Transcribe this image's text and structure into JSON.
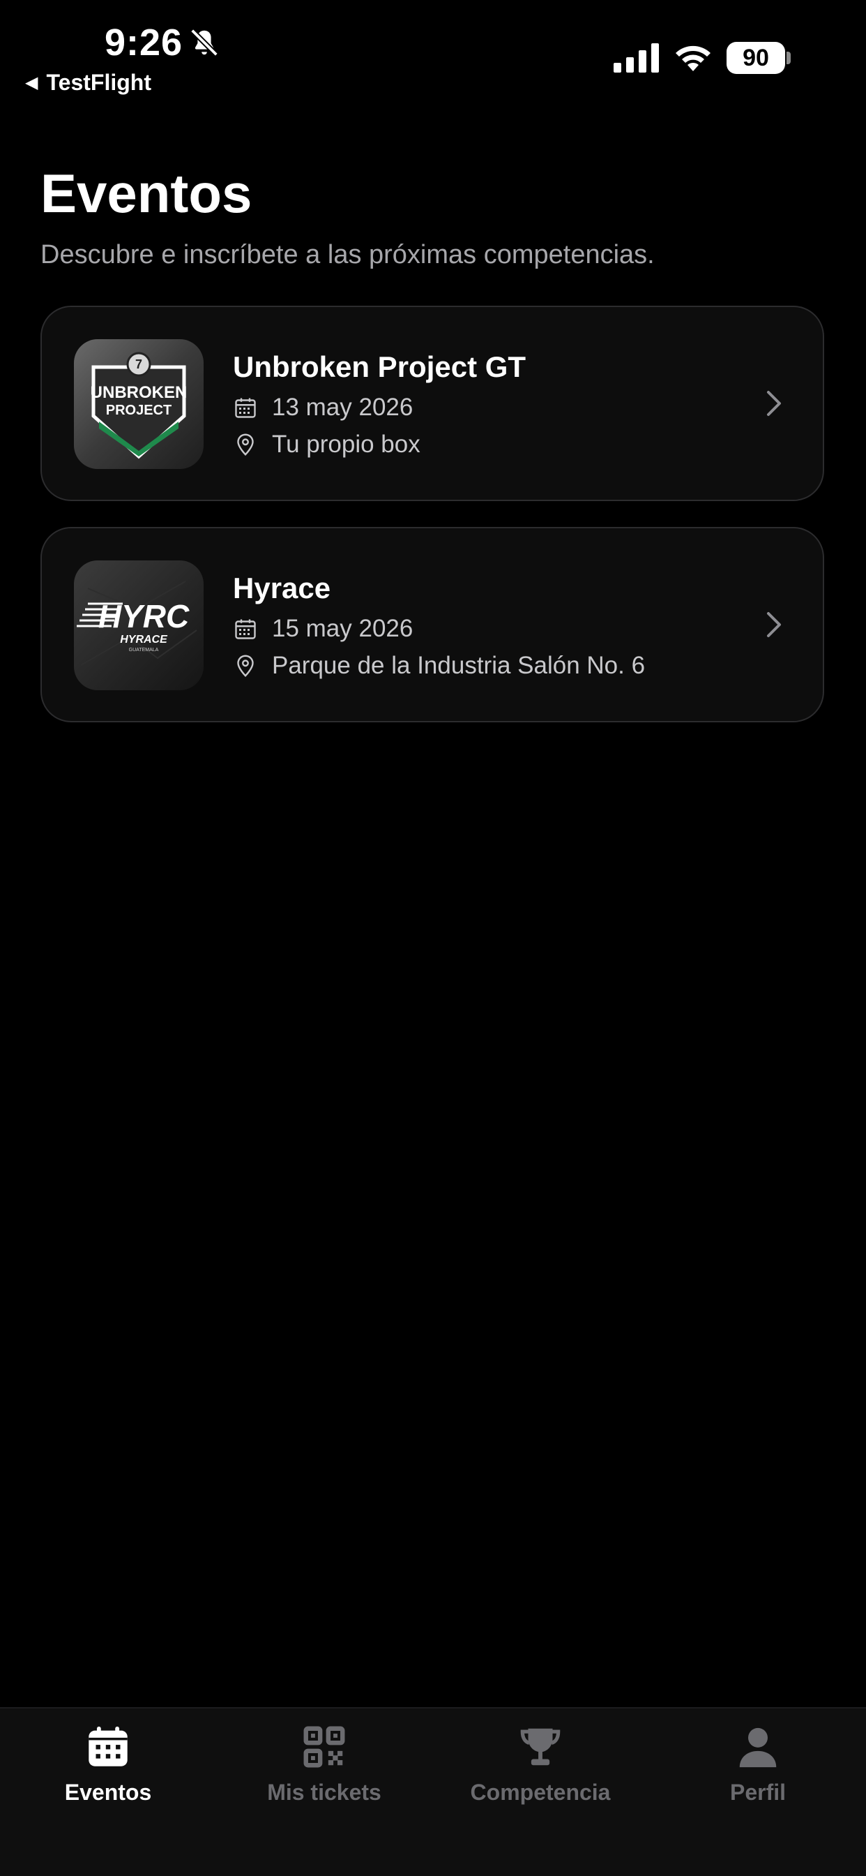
{
  "status_bar": {
    "time": "9:26",
    "back_app": "TestFlight",
    "battery": "90",
    "icons": [
      "bell-slash-icon",
      "cellular-signal-icon",
      "wifi-icon",
      "battery-icon"
    ]
  },
  "header": {
    "title": "Eventos",
    "subtitle": "Descubre e inscríbete a las próximas competencias."
  },
  "events": [
    {
      "name": "Unbroken Project GT",
      "date": "13 may 2026",
      "location": "Tu propio box",
      "logo_text": [
        "UNBROKEN",
        "PROJECT"
      ]
    },
    {
      "name": "Hyrace",
      "date": "15 may 2026",
      "location": "Parque de la Industria Salón No. 6",
      "logo_text": [
        "HYRC",
        "HYRACE",
        "GUATEMALA"
      ]
    }
  ],
  "tab_bar": {
    "tabs": [
      {
        "label": "Eventos",
        "icon": "calendar-icon",
        "active": true
      },
      {
        "label": "Mis tickets",
        "icon": "qr-code-icon",
        "active": false
      },
      {
        "label": "Competencia",
        "icon": "trophy-icon",
        "active": false
      },
      {
        "label": "Perfil",
        "icon": "person-icon",
        "active": false
      }
    ]
  },
  "colors": {
    "background": "#000000",
    "card_background": "#0d0d0d",
    "card_border": "#2c2c2e",
    "text_primary": "#ffffff",
    "text_secondary": "#a7a7ab",
    "tab_inactive": "#6b6b6f",
    "accent_green": "#1f8a4c"
  }
}
